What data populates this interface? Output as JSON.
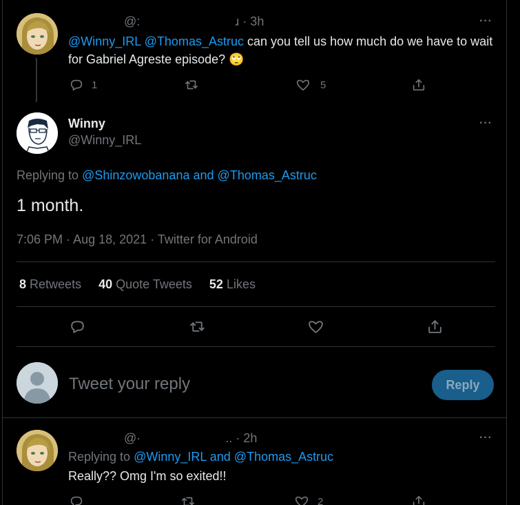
{
  "tweet1": {
    "handle_partial": "@:",
    "name_tail": "ɹ",
    "time": "· 3h",
    "mentions": [
      "@Winny_IRL",
      "@Thomas_Astruc"
    ],
    "text": "can you tell us how much do we have to wait for Gabriel Agreste episode?",
    "emoji": "🙄",
    "reply_count": "1",
    "like_count": "5"
  },
  "main_tweet": {
    "name": "Winny",
    "handle": "@Winny_IRL",
    "replying_prefix": "Replying to",
    "replying_user1": "@Shinzowobanana",
    "replying_and": "and",
    "replying_user2": "@Thomas_Astruc",
    "text": "1 month.",
    "time": "7:06 PM",
    "date": "Aug 18, 2021",
    "source": "Twitter for Android",
    "retweets_count": "8",
    "retweets_label": "Retweets",
    "quotes_count": "40",
    "quotes_label": "Quote Tweets",
    "likes_count": "52",
    "likes_label": "Likes"
  },
  "reply_box": {
    "placeholder": "Tweet your reply",
    "button": "Reply"
  },
  "tweet3": {
    "handle_partial": "@·",
    "name_tail": "..",
    "time": "· 2h",
    "replying_prefix": "Replying to",
    "replying_user1": "@Winny_IRL",
    "replying_and": "and",
    "replying_user2": "@Thomas_Astruc",
    "text": "Really?? Omg I'm so exited!!",
    "like_count": "2"
  },
  "more_glyph": "···",
  "colors": {
    "accent": "#1d9bf0",
    "background": "#000000",
    "muted": "#71767b",
    "reply_button": "#1a5e8b"
  }
}
